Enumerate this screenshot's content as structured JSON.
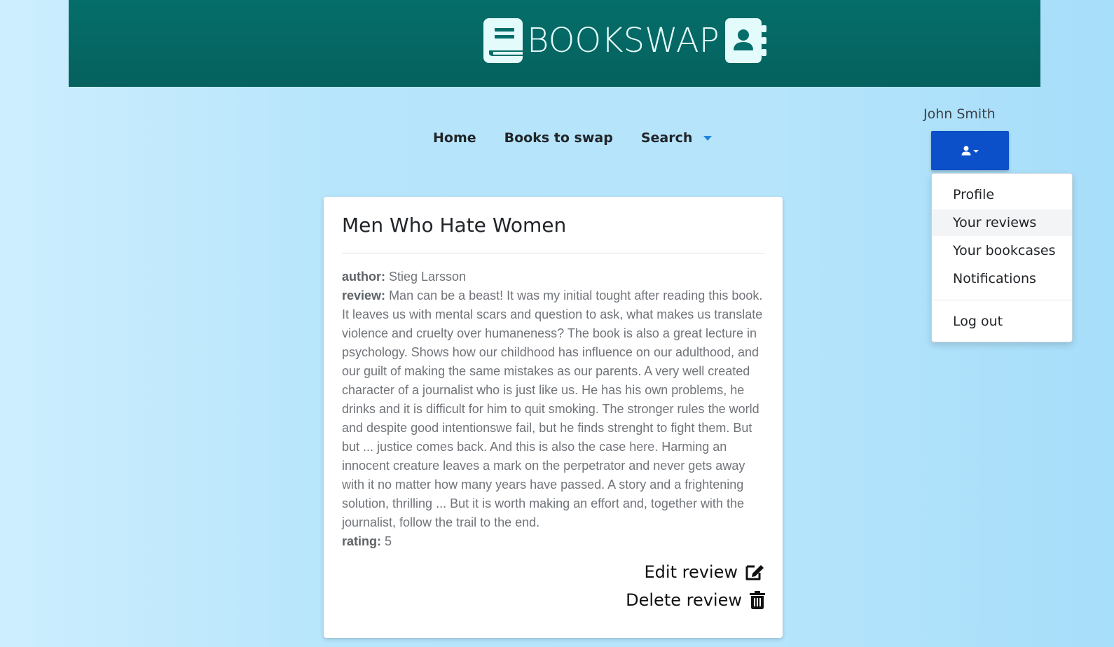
{
  "brand": {
    "name": "BOOKSWAP",
    "left_icon": "book-icon",
    "right_icon": "address-book-icon",
    "colors": {
      "header_bg": "#056e6a",
      "logo_fg": "#e4fbfb"
    }
  },
  "nav": {
    "items": [
      {
        "label": "Home"
      },
      {
        "label": "Books to swap"
      },
      {
        "label": "Search",
        "has_dropdown": true
      }
    ]
  },
  "user": {
    "name": "John Smith",
    "button_icon": "user-icon",
    "button_color": "#0b4fc9",
    "menu": {
      "items": [
        {
          "label": "Profile"
        },
        {
          "label": "Your reviews",
          "active": true
        },
        {
          "label": "Your bookcases"
        },
        {
          "label": "Notifications"
        },
        {
          "label": "Log out"
        }
      ]
    }
  },
  "review": {
    "title": "Men Who Hate Women",
    "author_label": "author:",
    "author": "Stieg Larsson",
    "review_label": "review:",
    "review_text": "Man can be a beast! It was my initial tought after reading this book. It leaves us with mental scars and question to ask, what makes us translate violence and cruelty over humaneness? The book is also a great lecture in psychology. Shows how our childhood has influence on our adulthood, and our guilt of making the same mistakes as our parents. A very well created character of a journalist who is just like us. He has his own problems, he drinks and it is difficult for him to quit smoking. The stronger rules the world and despite good intentionswe fail, but he finds strenght to fight them. But but ... justice comes back. And this is also the case here. Harming an innocent creature leaves a mark on the perpetrator and never gets away with it no matter how many years have passed. A story and a frightening solution, thrilling ... But it is worth making an effort and, together with the journalist, follow the trail to the end.",
    "rating_label": "rating:",
    "rating": "5",
    "edit_label": "Edit review",
    "edit_icon": "edit-icon",
    "delete_label": "Delete review",
    "delete_icon": "trash-icon"
  }
}
